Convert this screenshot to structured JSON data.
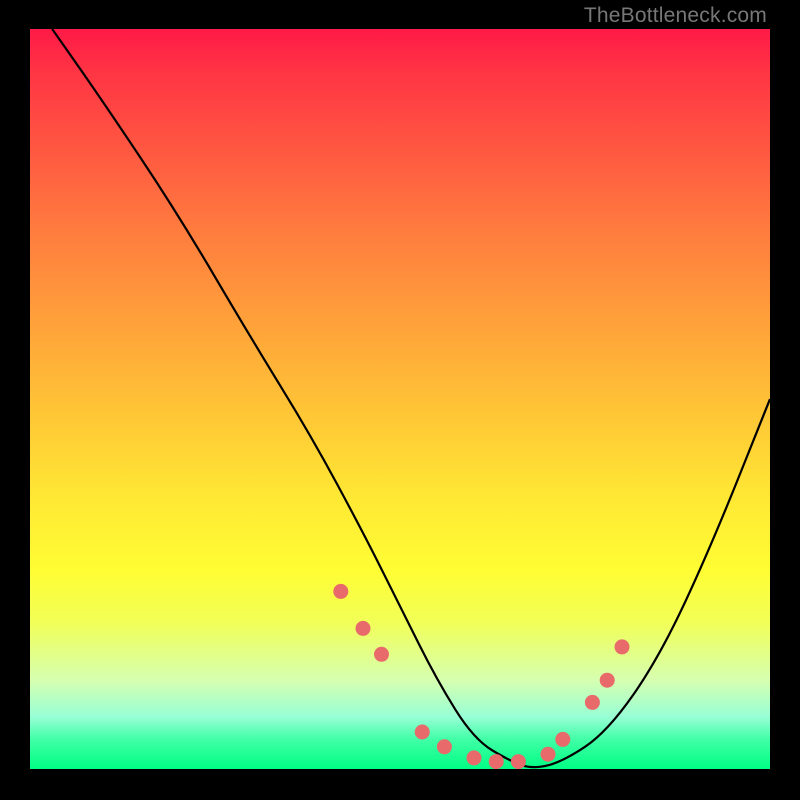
{
  "attribution": "TheBottleneck.com",
  "chart_data": {
    "type": "line",
    "title": "",
    "xlabel": "",
    "ylabel": "",
    "ylim": [
      0,
      100
    ],
    "xlim": [
      0,
      100
    ],
    "series": [
      {
        "name": "bottleneck-curve",
        "x": [
          3,
          10,
          20,
          30,
          38,
          45,
          50,
          55,
          60,
          65,
          68,
          72,
          78,
          85,
          92,
          100
        ],
        "y": [
          100,
          90,
          75,
          58,
          45,
          32,
          22,
          12,
          4,
          1,
          0,
          1,
          5,
          15,
          30,
          50
        ]
      }
    ],
    "markers": {
      "name": "highlight-points",
      "x": [
        42,
        45,
        47.5,
        53,
        56,
        60,
        63,
        66,
        70,
        72,
        76,
        78,
        80
      ],
      "y": [
        24,
        19,
        15.5,
        5,
        3,
        1.5,
        1,
        1,
        2,
        4,
        9,
        12,
        16.5
      ]
    },
    "colors": {
      "curve": "#000000",
      "marker_fill": "#e86a6a",
      "marker_stroke": "#d94f4f"
    }
  }
}
